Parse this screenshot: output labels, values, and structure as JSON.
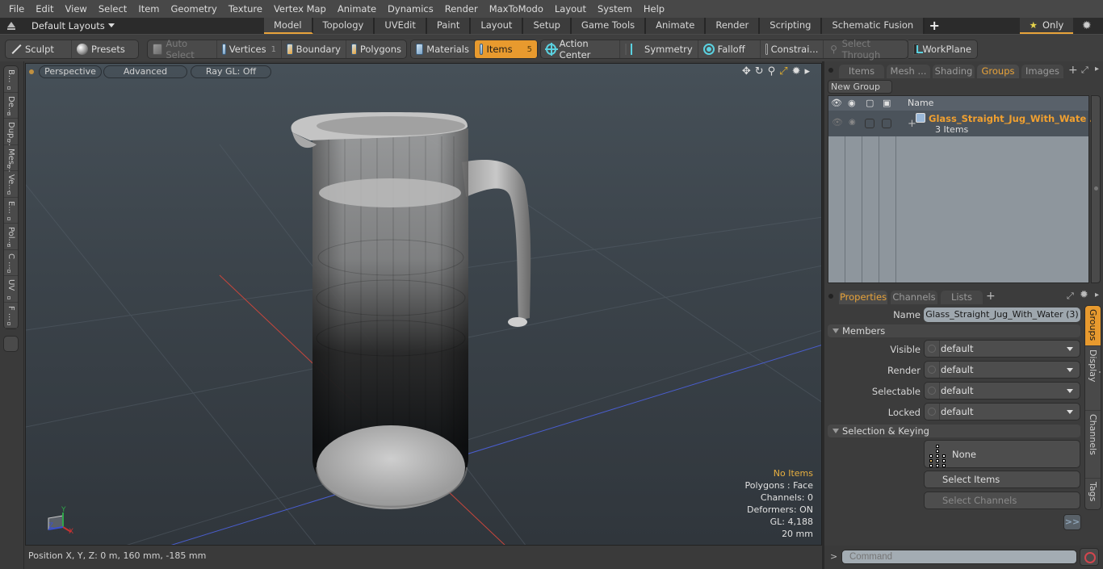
{
  "menu": [
    "File",
    "Edit",
    "View",
    "Select",
    "Item",
    "Geometry",
    "Texture",
    "Vertex Map",
    "Animate",
    "Dynamics",
    "Render",
    "MaxToModo",
    "Layout",
    "System",
    "Help"
  ],
  "layout_bar": {
    "layouts_label": "Default Layouts",
    "tabs": [
      "Model",
      "Topology",
      "UVEdit",
      "Paint",
      "Layout",
      "Setup",
      "Game Tools",
      "Animate",
      "Render",
      "Scripting",
      "Schematic Fusion"
    ],
    "active_tab": "Model",
    "add_label": "+",
    "only_label": "Only"
  },
  "toolbar": {
    "sculpt": "Sculpt",
    "presets": "Presets",
    "auto_select": "Auto Select",
    "vertices": "Vertices",
    "vertices_count": "1",
    "boundary": "Boundary",
    "polygons": "Polygons",
    "materials": "Materials",
    "items": "Items",
    "items_count": "5",
    "action_center": "Action Center",
    "symmetry": "Symmetry",
    "falloff": "Falloff",
    "constraints": "Constrai...",
    "select_through": "Select Through",
    "workplane": "WorkPlane"
  },
  "left_tabs": [
    "B...",
    "De...",
    "Dup...",
    "Mes...",
    "Ve...",
    "E...",
    "Pol...",
    "C ...",
    "UV",
    "F ..."
  ],
  "viewport": {
    "view_mode": "Perspective",
    "shading": "Advanced",
    "raygl": "Ray GL: Off",
    "stats": {
      "selection": "No Items",
      "polygons": "Polygons : Face",
      "channels": "Channels: 0",
      "deformers": "Deformers: ON",
      "gl": "GL: 4,188",
      "grid": "20 mm"
    },
    "axis_labels": {
      "x": "X",
      "y": "Y",
      "z": "Z"
    }
  },
  "status": {
    "position": "Position X, Y, Z:   0 m, 160 mm, -185 mm"
  },
  "groups_panel": {
    "tabs": [
      "Items",
      "Mesh ...",
      "Shading",
      "Groups",
      "Images"
    ],
    "active_tab": "Groups",
    "new_group": "New Group",
    "column_name": "Name",
    "rows": [
      {
        "name": "Glass_Straight_Jug_With_Wate ...",
        "sub": "3 Items"
      }
    ]
  },
  "properties_panel": {
    "tabs": [
      "Properties",
      "Channels",
      "Lists"
    ],
    "active_tab": "Properties",
    "name_label": "Name",
    "name_value": "Glass_Straight_Jug_With_Water (3)",
    "members_section": "Members",
    "fields": [
      {
        "label": "Visible",
        "value": "default"
      },
      {
        "label": "Render",
        "value": "default"
      },
      {
        "label": "Selectable",
        "value": "default"
      },
      {
        "label": "Locked",
        "value": "default"
      }
    ],
    "selection_section": "Selection & Keying",
    "hierarchy_value": "None",
    "select_items": "Select Items",
    "select_channels": "Select Channels",
    "more": ">>",
    "side_tabs": [
      "Groups",
      "Group Display",
      "User Channels",
      "Tags"
    ],
    "active_side_tab": "Groups"
  },
  "command": {
    "prompt": ">",
    "placeholder": "Command"
  },
  "colors": {
    "accent": "#e89a2e",
    "group_name": "#f0a030",
    "axis_x": "#c8463c",
    "axis_z": "#4a5ed0"
  }
}
